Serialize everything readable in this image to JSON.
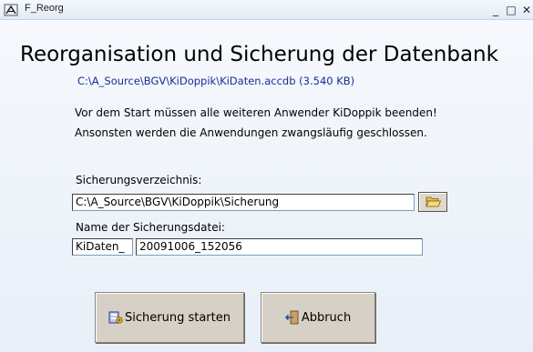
{
  "window": {
    "title": "F_Reorg",
    "minimize": "_",
    "restore": "□",
    "close": "✕"
  },
  "heading": "Reorganisation und Sicherung  der Datenbank",
  "database_path": "C:\\A_Source\\BGV\\KiDoppik\\KiDaten.accdb (3.540 KB)",
  "warning": {
    "line1": "Vor dem Start müssen alle weiteren Anwender KiDoppik beenden!",
    "line2": "Ansonsten werden die Anwendungen zwangsläufig geschlossen."
  },
  "backup_dir": {
    "label": "Sicherungsverzeichnis:",
    "value": "C:\\A_Source\\BGV\\KiDoppik\\Sicherung",
    "browse_icon": "folder-open-icon"
  },
  "backup_file": {
    "label": "Name der Sicherungsdatei:",
    "prefix": "KiDaten_",
    "suffix": "20091006_152056"
  },
  "buttons": {
    "start": {
      "label": "Sicherung starten",
      "icon": "database-backup-icon"
    },
    "cancel": {
      "label": "Abbruch",
      "icon": "exit-door-icon"
    }
  },
  "colors": {
    "background": "#eef3fa",
    "path_text": "#1a2a9a",
    "button_face": "#d6d0c6"
  }
}
